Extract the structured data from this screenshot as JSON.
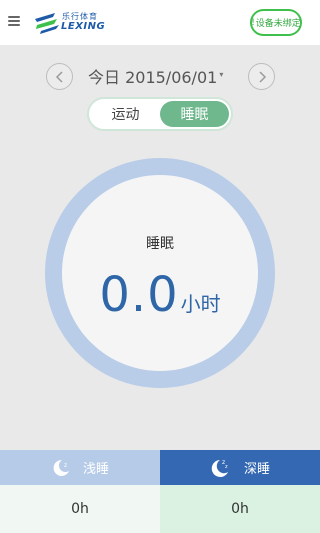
{
  "header": {
    "logo": {
      "text_cn": "乐行体育",
      "text_en": "LEXING"
    },
    "device_button": {
      "prefix": "!",
      "label": "设备未绑定"
    },
    "menu_icon": "menu-icon"
  },
  "date_nav": {
    "date": "今日 2015/06/01",
    "caret": "▾",
    "prev_icon": "chevron-left-icon",
    "next_icon": "chevron-right-icon"
  },
  "toggle": {
    "options": [
      "运动",
      "睡眠"
    ],
    "selected": "睡眠"
  },
  "summary": {
    "title": "睡眠",
    "value": "0.0",
    "unit": "小时"
  },
  "legend": [
    {
      "label": "浅睡",
      "value": "0h",
      "color": "#b6cbe8",
      "icon": "moon-icon"
    },
    {
      "label": "深睡",
      "value": "0h",
      "color": "#3568b2",
      "icon": "moon-zzz-icon"
    }
  ],
  "colors": {
    "accent_green": "#6fb88d",
    "ring": "#b9cde8",
    "value_blue": "#2f66a8",
    "device_border": "#3fbf4b"
  }
}
